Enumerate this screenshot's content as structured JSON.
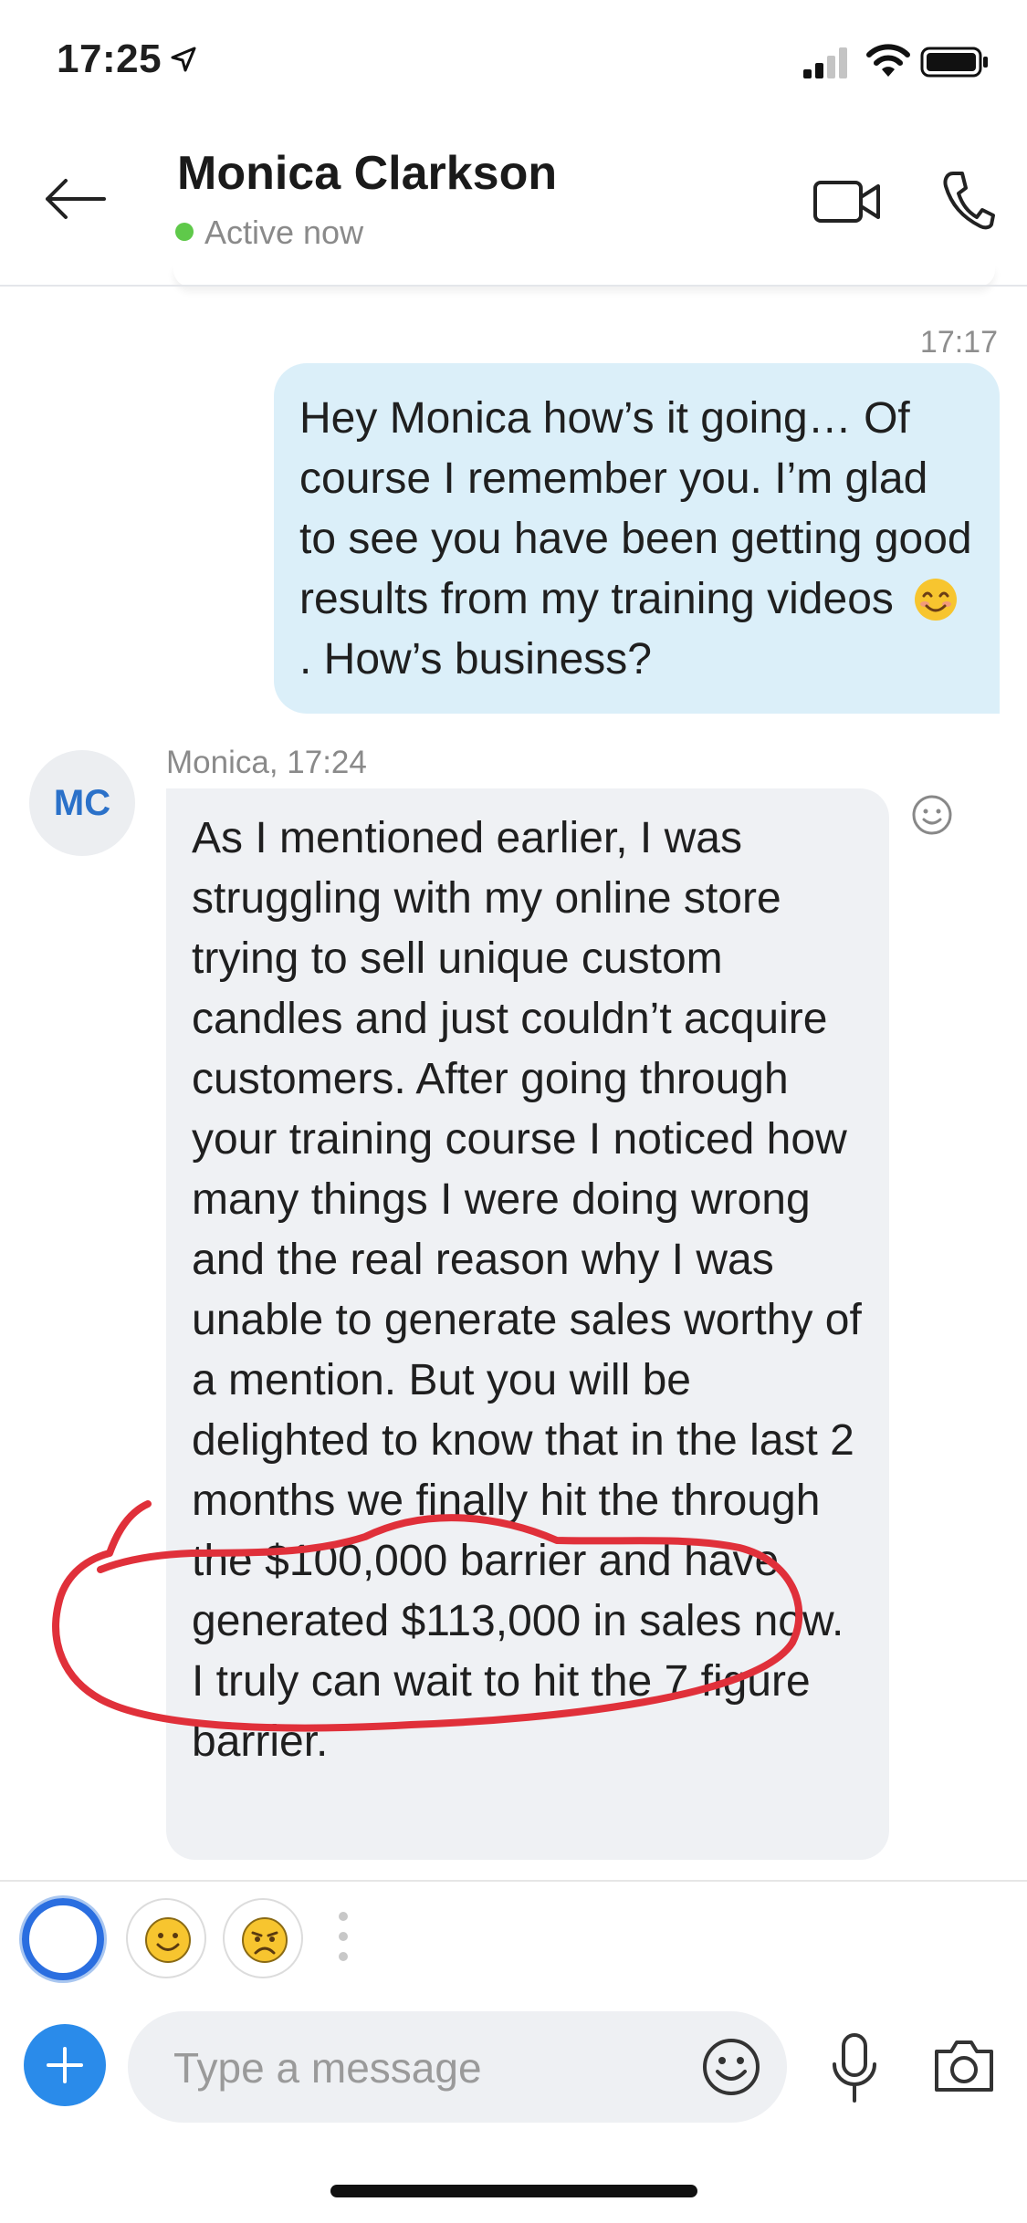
{
  "status_bar": {
    "time": "17:25"
  },
  "header": {
    "contact_name": "Monica Clarkson",
    "presence": "Active now",
    "presence_color": "#5fc94a"
  },
  "messages": {
    "outgoing": {
      "time": "17:17",
      "text_before_emoji": "Hey Monica how’s it going… Of course I remember you. I’m glad to see you have been getting good results from my training videos",
      "emoji": "smiling-face",
      "text_after_emoji": ". How’s business?",
      "bubble_color": "#dbeff9"
    },
    "incoming": {
      "avatar_initials": "MC",
      "sender_meta": "Monica, 17:24",
      "text": "As I mentioned earlier, I was struggling with my online store trying to sell unique custom candles and just couldn’t acquire customers. After going through your training course I noticed how many things I were doing wrong and the real reason why I was unable to generate sales worthy of a mention. But you will be delighted to know that in the last 2 months we finally hit the through the $100,000 barrier and have generated $113,000 in sales now. I truly can wait to hit the 7 figure barrier.",
      "bubble_color": "#eff1f4",
      "annotation_color": "#e0303a"
    }
  },
  "quick_reactions": [
    "ring",
    "smile-emoji",
    "frown-emoji"
  ],
  "compose": {
    "placeholder": "Type a message"
  },
  "accent_color": "#2a8bea"
}
